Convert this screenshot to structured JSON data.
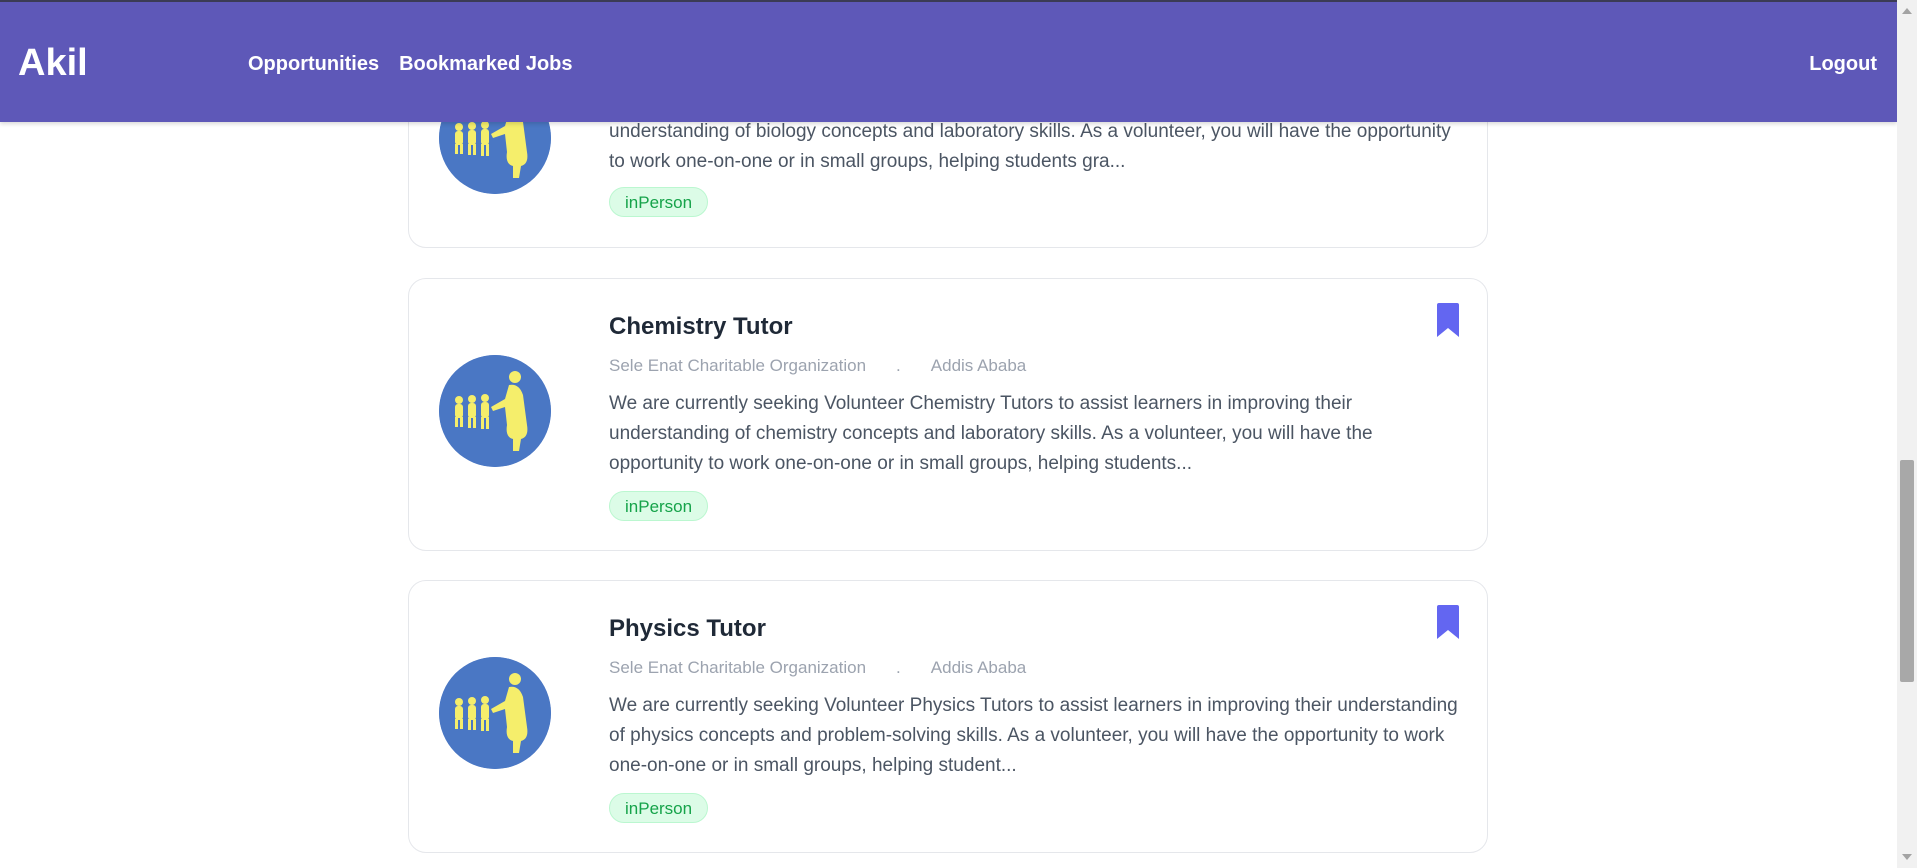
{
  "nav": {
    "brand": "Akil",
    "links": [
      "Opportunities",
      "Bookmarked Jobs"
    ],
    "logout": "Logout"
  },
  "colors": {
    "nav_bg": "#5e58b8",
    "bookmark": "#6366f1",
    "badge_text": "#16a34a",
    "badge_bg": "#dcfce7",
    "avatar_bg": "#4a77c4",
    "avatar_figures": "#f5ee6b"
  },
  "jobs": [
    {
      "title": "",
      "organization": "",
      "separator": "",
      "location": "",
      "description": "understanding of biology concepts and laboratory skills. As a volunteer, you will have the opportunity to work one-on-one or in small groups, helping students gra...",
      "tag": "inPerson",
      "avatar_icon": "charity-logo-icon",
      "bookmark_icon": "bookmark-icon"
    },
    {
      "title": "Chemistry Tutor",
      "organization": "Sele Enat Charitable Organization",
      "separator": ".",
      "location": "Addis Ababa",
      "description": "We are currently seeking Volunteer Chemistry Tutors to assist learners in improving their understanding of chemistry concepts and laboratory skills. As a volunteer, you will have the opportunity to work one-on-one or in small groups, helping students...",
      "tag": "inPerson",
      "avatar_icon": "charity-logo-icon",
      "bookmark_icon": "bookmark-icon"
    },
    {
      "title": "Physics Tutor",
      "organization": "Sele Enat Charitable Organization",
      "separator": ".",
      "location": "Addis Ababa",
      "description": "We are currently seeking Volunteer Physics Tutors to assist learners in improving their understanding of physics concepts and problem-solving skills. As a volunteer, you will have the opportunity to work one-on-one or in small groups, helping student...",
      "tag": "inPerson",
      "avatar_icon": "charity-logo-icon",
      "bookmark_icon": "bookmark-icon"
    }
  ]
}
